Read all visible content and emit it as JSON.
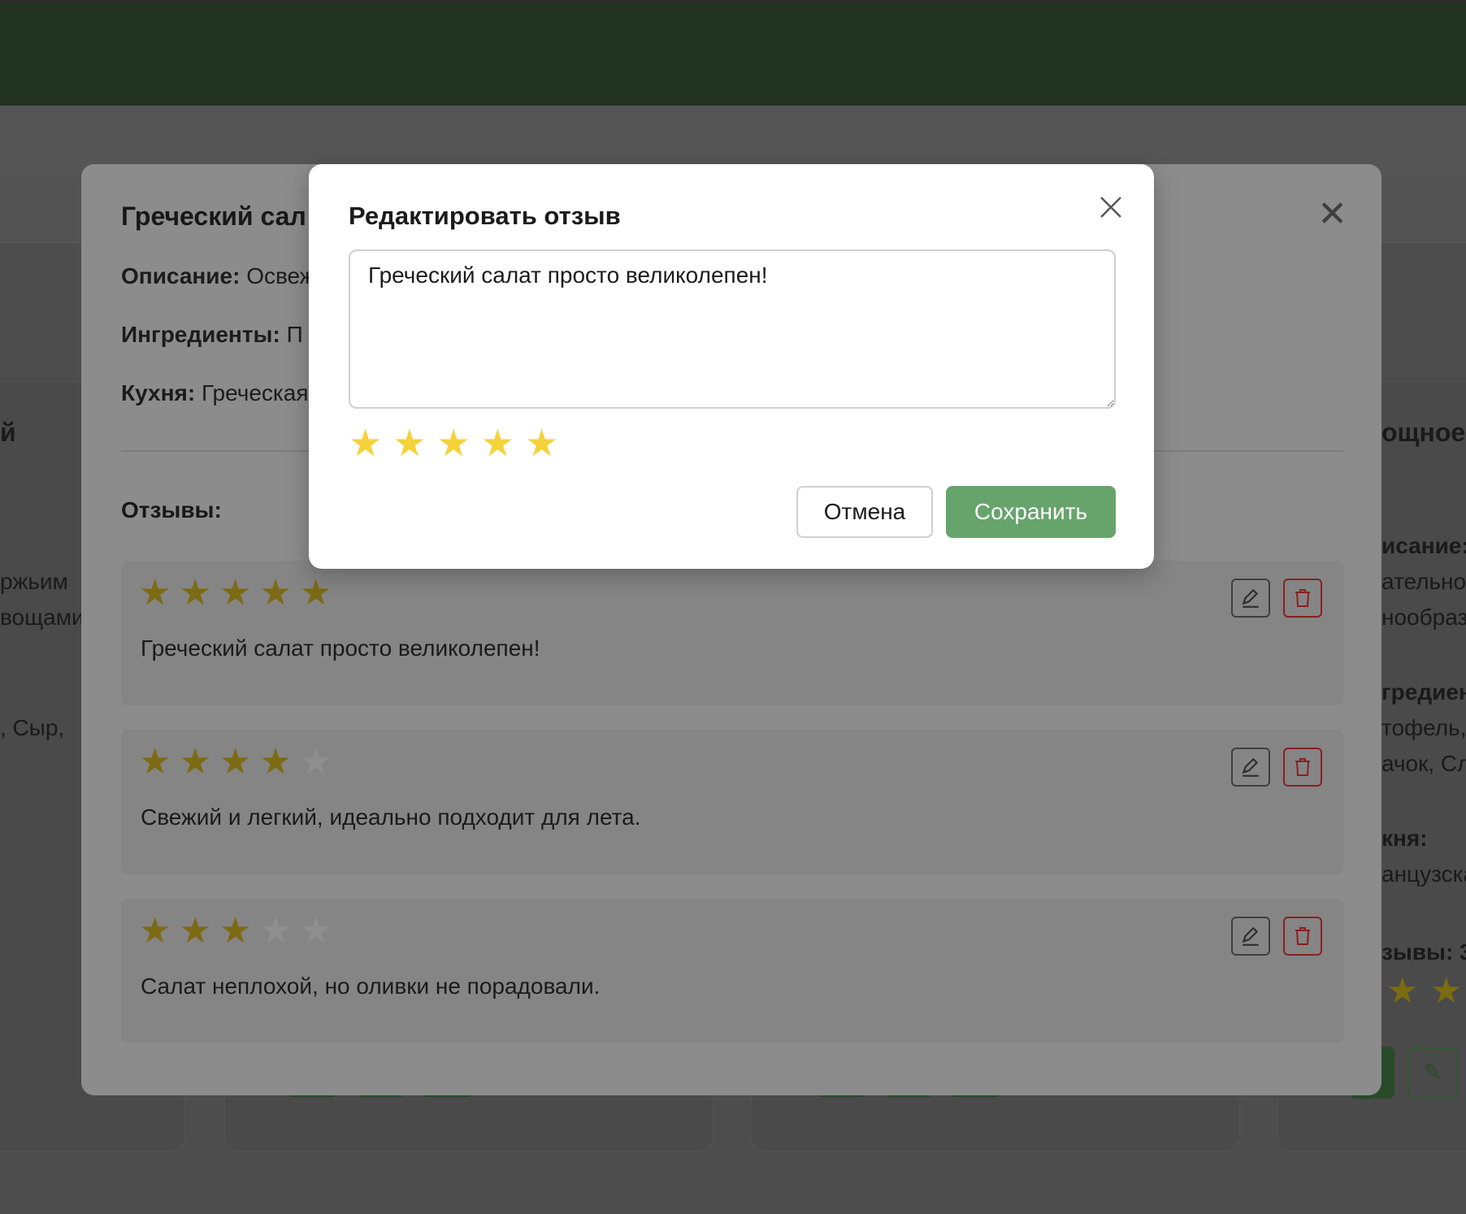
{
  "background": {
    "left_column": {
      "heading_fragment": "й",
      "lines": [
        "ржьим",
        "вощами",
        ", Сыр,"
      ]
    },
    "right_column": {
      "heading_fragment": "ощное",
      "lines": [
        "исание:",
        "ательно",
        "нообраз",
        "гредиен",
        "тофель,",
        "ачок, Сл",
        "кня:",
        "анцузска",
        "зывы: 3"
      ]
    }
  },
  "recipe_modal": {
    "title": "Греческий сал",
    "description_label": "Описание:",
    "description_value": "Освеж",
    "ingredients_label": "Ингредиенты:",
    "ingredients_value": "П",
    "cuisine_label": "Кухня:",
    "cuisine_value": "Греческая",
    "reviews_label": "Отзывы:",
    "reviews": [
      {
        "rating": 5,
        "text": "Греческий салат просто великолепен!"
      },
      {
        "rating": 4,
        "text": "Свежий и легкий, идеально подходит для лета."
      },
      {
        "rating": 3,
        "text": "Салат неплохой, но оливки не порадовали."
      }
    ]
  },
  "edit_modal": {
    "title": "Редактировать отзыв",
    "review_text": "Греческий салат просто великолепен!",
    "rating": 5,
    "max_rating": 5,
    "cancel_label": "Отмена",
    "save_label": "Сохранить"
  },
  "colors": {
    "header": "#213222",
    "star_active": "#f5d23a",
    "save_button": "#67a46b",
    "delete_button_border": "#8a2020"
  }
}
